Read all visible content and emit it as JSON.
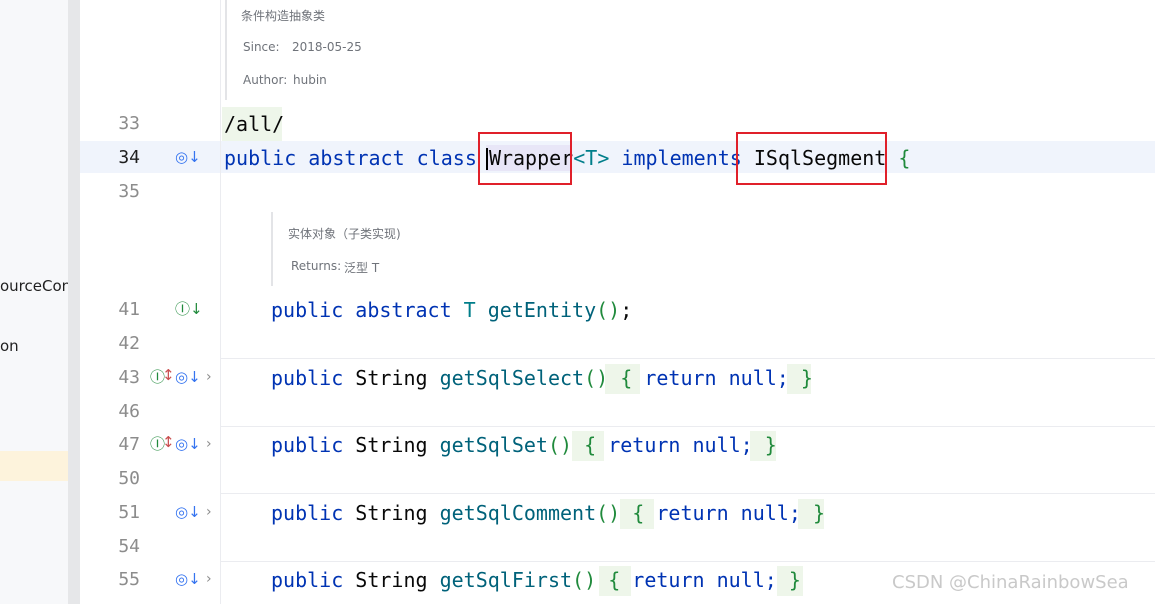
{
  "sidebar": {
    "items": [
      "ourceConfig",
      "on"
    ]
  },
  "header_doc": {
    "description": "条件构造抽象类",
    "since_label": "Since:",
    "since_value": "2018-05-25",
    "author_label": "Author:",
    "author_value": "hubin"
  },
  "method_doc": {
    "description": "实体对象（子类实现)",
    "returns_label": "Returns:",
    "returns_value": "泛型 T"
  },
  "line_numbers": [
    "33",
    "34",
    "35",
    "41",
    "42",
    "43",
    "46",
    "47",
    "50",
    "51",
    "54",
    "55"
  ],
  "code": {
    "path_line": "/all/",
    "class_line": {
      "kw1": "public",
      "kw2": "abstract",
      "kw3": "class",
      "class_name": "Wrapper",
      "type_param": "<T>",
      "kw4": "implements",
      "interface_name": "ISqlSegment",
      "brace": "{"
    },
    "get_entity": {
      "kw1": "public",
      "kw2": "abstract",
      "type": "T",
      "name": "getEntity",
      "parens": "()",
      "semi": ";"
    },
    "methods": [
      {
        "kw": "public",
        "type": "String",
        "name": "getSqlSelect",
        "parens": "()",
        "open": "{",
        "ret": "return",
        "val": "null;",
        "close": "}"
      },
      {
        "kw": "public",
        "type": "String",
        "name": "getSqlSet",
        "parens": "()",
        "open": "{",
        "ret": "return",
        "val": "null;",
        "close": "}"
      },
      {
        "kw": "public",
        "type": "String",
        "name": "getSqlComment",
        "parens": "()",
        "open": "{",
        "ret": "return",
        "val": "null;",
        "close": "}"
      },
      {
        "kw": "public",
        "type": "String",
        "name": "getSqlFirst",
        "parens": "()",
        "open": "{",
        "ret": "return",
        "val": "null;",
        "close": "}"
      }
    ]
  },
  "watermark": "CSDN @ChinaRainbowSea",
  "colors": {
    "keyword": "#0033b3",
    "method": "#00627a",
    "highlight_box": "#e0202a"
  }
}
